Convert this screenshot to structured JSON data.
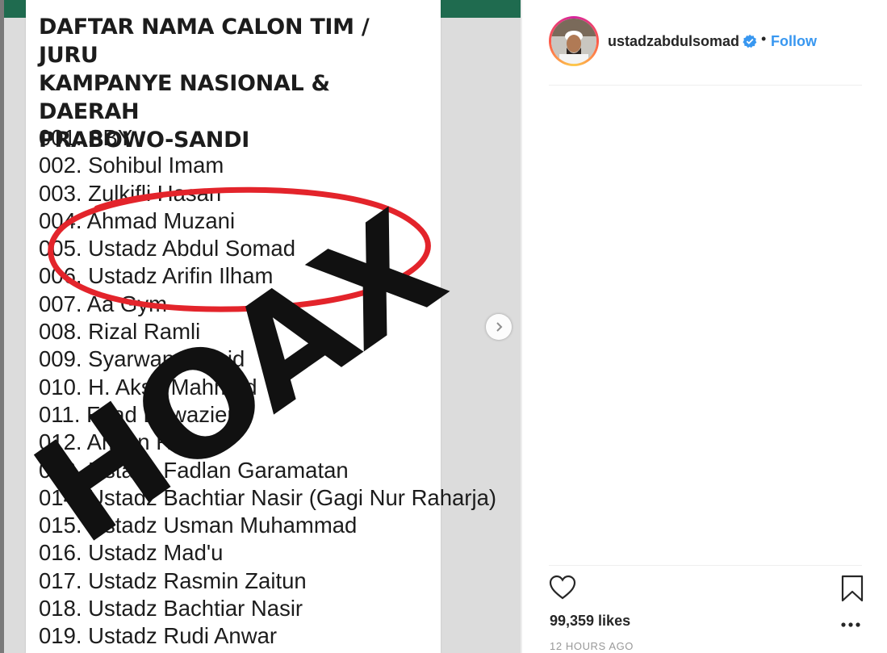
{
  "post": {
    "document_title": "DAFTAR NAMA CALON TIM / JURU\nKAMPANYE NASIONAL & DAERAH\nPRABOWO-SANDI",
    "names": [
      "001. SBY",
      "002. Sohibul Imam",
      "003. Zulkifli Hasan",
      "004. Ahmad Muzani",
      "005. Ustadz Abdul Somad",
      "006. Ustadz Arifin Ilham",
      "007. Aa Gym",
      "008. Rizal Ramli",
      "009. Syarwan Hamid",
      "010. H. Aksa Mahmud",
      "011. Fuad Bawazier",
      "012. Amien Rais",
      "013. Ustadz Fadlan Garamatan",
      "014. Ustadz Bachtiar Nasir (Gagi Nur Raharja)",
      "015. Ustadz Usman Muhammad",
      "016. Ustadz Mad'u",
      "017. Ustadz Rasmin Zaitun",
      "018. Ustadz Bachtiar Nasir",
      "019. Ustadz Rudi Anwar"
    ],
    "stamp_text": "HOAX",
    "highlight_color": "#e3242b",
    "stamp_color": "#111111"
  },
  "header": {
    "username": "ustadzabdulsomad",
    "separator": "•",
    "follow_label": "Follow",
    "verified_icon": "verified-badge-icon"
  },
  "actions": {
    "like_icon": "heart-icon",
    "save_icon": "bookmark-icon",
    "more_icon": "more-options-icon",
    "next_icon": "chevron-right-icon"
  },
  "stats": {
    "likes": "99,359 likes",
    "timestamp": "12 HOURS AGO"
  },
  "colors": {
    "accent": "#3897f0",
    "verified": "#3897f0",
    "text": "#262626",
    "muted": "#999999"
  }
}
